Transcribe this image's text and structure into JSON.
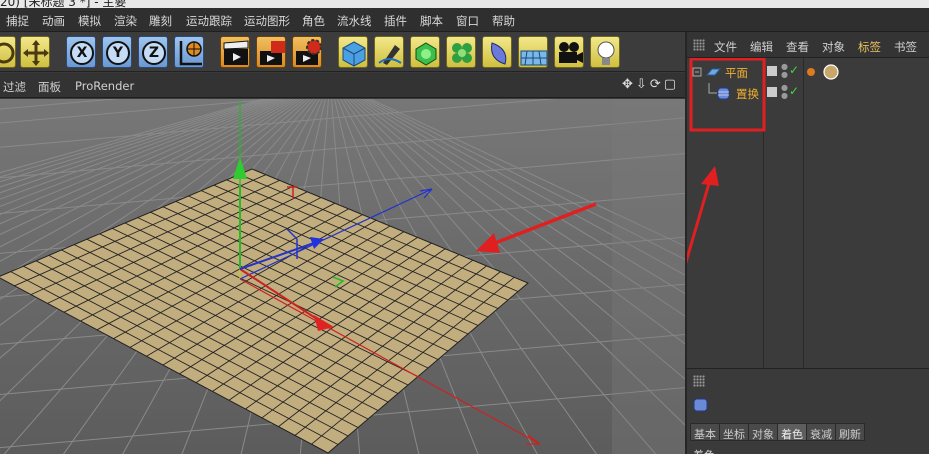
{
  "window": {
    "title": "20) [未标题 3 *] - 主要"
  },
  "menu": {
    "items": [
      "捕捉",
      "动画",
      "模拟",
      "渲染",
      "雕刻",
      "运动跟踪",
      "运动图形",
      "角色",
      "流水线",
      "插件",
      "脚本",
      "窗口",
      "帮助"
    ]
  },
  "toolbar": {
    "axis_x": "X",
    "axis_y": "Y",
    "axis_z": "Z"
  },
  "viewport": {
    "menu": [
      "过滤",
      "面板",
      "ProRender"
    ],
    "nav_icons": "✥⇩⟳▢",
    "colors": {
      "plane": "#c2ad7e",
      "grid": "#222222",
      "background": "#6b6b6b",
      "x_axis": "#cc2222",
      "y_axis": "#22bb22",
      "z_axis": "#2233cc",
      "annotation": "#e02020"
    }
  },
  "object_manager": {
    "menu": [
      "文件",
      "编辑",
      "查看",
      "对象",
      "标签",
      "书签"
    ],
    "active_menu": "标签",
    "objects": [
      {
        "name": "平面",
        "icon": "plane-object-icon"
      },
      {
        "name": "置换",
        "icon": "displace-deformer-icon"
      }
    ]
  },
  "attribute_manager": {
    "tabs": [
      "基本",
      "坐标",
      "对象",
      "着色",
      "衰减",
      "刷新"
    ],
    "active_tab": "着色",
    "section_label": "着色"
  }
}
